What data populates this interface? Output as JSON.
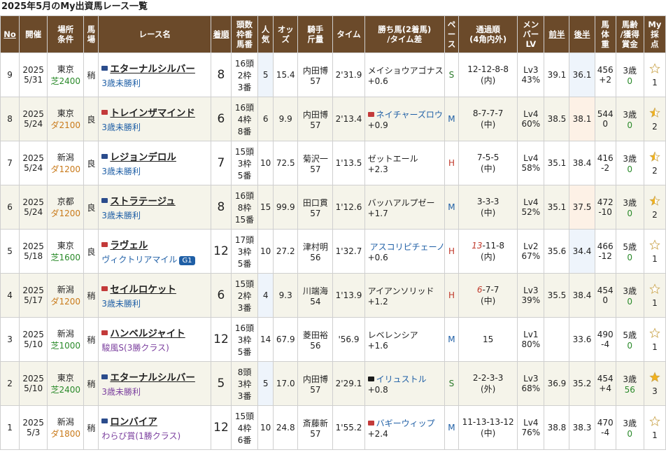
{
  "title": "2025年5月のMy出資馬レース一覧",
  "headers": [
    "No",
    "開催",
    "場所\n条件",
    "馬\n場",
    "レース名",
    "着順",
    "頭数\n枠番\n馬番",
    "人\n気",
    "オッ\nズ",
    "騎手\n斤量",
    "タイム",
    "勝ち馬(2着馬)\n/タイム差",
    "ペ\nー\nス",
    "通過順\n(4角内外)",
    "メン\nバー\nLV",
    "前半",
    "後半",
    "馬\n体\n重",
    "馬齢\n/獲得\n賞金",
    "My\n採\n点"
  ],
  "rows": [
    {
      "no": "9",
      "year": "2025",
      "date": "5/31",
      "place": "東京",
      "course": "芝2400",
      "baba": "稍",
      "flag": "#2b4c8c",
      "horse": "エターナルシルバー",
      "race": "3歳未勝利",
      "racecolor": "blue",
      "grade": "",
      "rank": "8",
      "heads": "16頭",
      "waku": "2枠",
      "umaban": "3番",
      "pop": "5",
      "odds": "15.4",
      "jockey": "内田博",
      "weight": "57",
      "time": "2'31.9",
      "winner": "メイショウアゴナス",
      "wflag": "",
      "diff": "+0.6",
      "pace": "S",
      "pass_pre": "",
      "pass": "12-12-8-8",
      "pos": "(内)",
      "lv": "Lv3",
      "lvpct": "43%",
      "first": "39.1",
      "second": "36.1",
      "bw": "456",
      "bwd": "+2",
      "age": "3歳",
      "prize": "0",
      "score": "1",
      "star": "empty"
    },
    {
      "no": "8",
      "year": "2025",
      "date": "5/24",
      "place": "東京",
      "course": "ダ2100",
      "baba": "良",
      "flag": "#c33a3a",
      "horse": "トレインザマインド",
      "race": "3歳未勝利",
      "racecolor": "blue",
      "grade": "",
      "rank": "6",
      "heads": "16頭",
      "waku": "4枠",
      "umaban": "8番",
      "pop": "6",
      "odds": "9.9",
      "jockey": "内田博",
      "weight": "57",
      "time": "2'13.4",
      "winner": "ネイチャーズロウ",
      "wflag": "#c33a3a",
      "diff": "+0.9",
      "pace": "M",
      "pass_pre": "",
      "pass": "8-7-7-7",
      "pos": "(中)",
      "lv": "Lv4",
      "lvpct": "60%",
      "first": "38.5",
      "second": "38.1",
      "bw": "544",
      "bwd": "0",
      "age": "3歳",
      "prize": "0",
      "score": "2",
      "star": "half"
    },
    {
      "no": "7",
      "year": "2025",
      "date": "5/24",
      "place": "新潟",
      "course": "ダ1200",
      "baba": "良",
      "flag": "#2b4c8c",
      "horse": "レジョンデロル",
      "race": "3歳未勝利",
      "racecolor": "blue",
      "grade": "",
      "rank": "7",
      "heads": "15頭",
      "waku": "3枠",
      "umaban": "5番",
      "pop": "10",
      "odds": "72.5",
      "jockey": "菊沢一",
      "weight": "57",
      "time": "1'13.5",
      "winner": "ゼットエール",
      "wflag": "",
      "diff": "+2.3",
      "pace": "H",
      "pass_pre": "",
      "pass": "7-5-5",
      "pos": "(中)",
      "lv": "Lv4",
      "lvpct": "58%",
      "first": "35.1",
      "second": "38.4",
      "bw": "416",
      "bwd": "-2",
      "age": "3歳",
      "prize": "0",
      "score": "2",
      "star": "half"
    },
    {
      "no": "6",
      "year": "2025",
      "date": "5/24",
      "place": "京都",
      "course": "ダ1200",
      "baba": "良",
      "flag": "#2b4c8c",
      "horse": "ストラテージュ",
      "race": "3歳未勝利",
      "racecolor": "blue",
      "grade": "",
      "rank": "8",
      "heads": "16頭",
      "waku": "8枠",
      "umaban": "15番",
      "pop": "15",
      "odds": "99.9",
      "jockey": "田口貫",
      "weight": "57",
      "time": "1'12.6",
      "winner": "バッハアルプゼー",
      "wflag": "",
      "diff": "+1.7",
      "pace": "M",
      "pass_pre": "",
      "pass": "3-3-3",
      "pos": "(中)",
      "lv": "Lv4",
      "lvpct": "52%",
      "first": "35.1",
      "second": "37.5",
      "bw": "472",
      "bwd": "-10",
      "age": "3歳",
      "prize": "0",
      "score": "2",
      "star": "half"
    },
    {
      "no": "5",
      "year": "2025",
      "date": "5/18",
      "place": "東京",
      "course": "芝1600",
      "baba": "良",
      "flag": "#c33a3a",
      "horse": "ラヴェル",
      "race": "ヴィクトリアマイル",
      "racecolor": "blue",
      "grade": "G1",
      "rank": "12",
      "heads": "17頭",
      "waku": "3枠",
      "umaban": "5番",
      "pop": "10",
      "odds": "27.2",
      "jockey": "津村明",
      "weight": "56",
      "time": "1'32.7",
      "winner": "アスコリピチェーノ",
      "wflag": "#8b1a1a",
      "diff": "+0.6",
      "pace": "H",
      "pass_pre": "13",
      "pass": "-11-8",
      "pos": "(内)",
      "lv": "Lv2",
      "lvpct": "67%",
      "first": "35.6",
      "second": "34.4",
      "bw": "466",
      "bwd": "-12",
      "age": "5歳",
      "prize": "0",
      "score": "1",
      "star": "empty"
    },
    {
      "no": "4",
      "year": "2025",
      "date": "5/17",
      "place": "新潟",
      "course": "ダ1200",
      "baba": "稍",
      "flag": "#c33a3a",
      "horse": "セイルロケット",
      "race": "3歳未勝利",
      "racecolor": "blue",
      "grade": "",
      "rank": "6",
      "heads": "15頭",
      "waku": "2枠",
      "umaban": "3番",
      "pop": "4",
      "odds": "9.3",
      "jockey": "川端海",
      "weight": "54",
      "time": "1'13.9",
      "winner": "アイアンソリッド",
      "wflag": "",
      "diff": "+1.2",
      "pace": "H",
      "pass_pre": "6",
      "pass": "-7-7",
      "pos": "(中)",
      "lv": "Lv3",
      "lvpct": "39%",
      "first": "35.5",
      "second": "38.4",
      "bw": "454",
      "bwd": "0",
      "age": "3歳",
      "prize": "0",
      "score": "1",
      "star": "empty"
    },
    {
      "no": "3",
      "year": "2025",
      "date": "5/10",
      "place": "新潟",
      "course": "芝1000",
      "baba": "稍",
      "flag": "#c33a3a",
      "horse": "ハンベルジャイト",
      "race": "駿風S(3勝クラス)",
      "racecolor": "purple",
      "grade": "",
      "rank": "12",
      "heads": "16頭",
      "waku": "3枠",
      "umaban": "5番",
      "pop": "14",
      "odds": "67.9",
      "jockey": "菱田裕",
      "weight": "56",
      "time": "'56.9",
      "winner": "レベレンシア",
      "wflag": "",
      "diff": "+1.6",
      "pace": "M",
      "pass_pre": "",
      "pass": "15",
      "pos": "",
      "lv": "Lv1",
      "lvpct": "80%",
      "first": "",
      "second": "33.6",
      "bw": "490",
      "bwd": "-4",
      "age": "5歳",
      "prize": "0",
      "score": "1",
      "star": "empty"
    },
    {
      "no": "2",
      "year": "2025",
      "date": "5/10",
      "place": "東京",
      "course": "芝2400",
      "baba": "稍",
      "flag": "#2b4c8c",
      "horse": "エターナルシルバー",
      "race": "3歳未勝利",
      "racecolor": "purple",
      "grade": "",
      "rank": "5",
      "heads": "8頭",
      "waku": "3枠",
      "umaban": "3番",
      "pop": "5",
      "odds": "17.0",
      "jockey": "内田博",
      "weight": "57",
      "time": "2'29.1",
      "winner": "イリュストル",
      "wflag": "#1a1a1a",
      "diff": "+0.8",
      "pace": "S",
      "pass_pre": "",
      "pass": "2-2-3-3",
      "pos": "(外)",
      "lv": "Lv3",
      "lvpct": "68%",
      "first": "36.9",
      "second": "35.2",
      "bw": "454",
      "bwd": "+4",
      "age": "3歳",
      "prize": "56",
      "score": "3",
      "star": "full"
    },
    {
      "no": "1",
      "year": "2025",
      "date": "5/3",
      "place": "新潟",
      "course": "ダ1800",
      "baba": "稍",
      "flag": "#2b4c8c",
      "horse": "ロンバイア",
      "race": "わらび賞(1勝クラス)",
      "racecolor": "purple",
      "grade": "",
      "rank": "12",
      "heads": "15頭",
      "waku": "4枠",
      "umaban": "6番",
      "pop": "10",
      "odds": "24.8",
      "jockey": "斎藤新",
      "weight": "57",
      "time": "1'55.2",
      "winner": "バギーウィップ",
      "wflag": "#c33a3a",
      "diff": "+2.4",
      "pace": "M",
      "pass_pre": "",
      "pass": "11-13-13-12",
      "pos": "(中)",
      "lv": "Lv4",
      "lvpct": "76%",
      "first": "38.8",
      "second": "38.3",
      "bw": "470",
      "bwd": "-4",
      "age": "3歳",
      "prize": "0",
      "score": "1",
      "star": "empty"
    }
  ]
}
